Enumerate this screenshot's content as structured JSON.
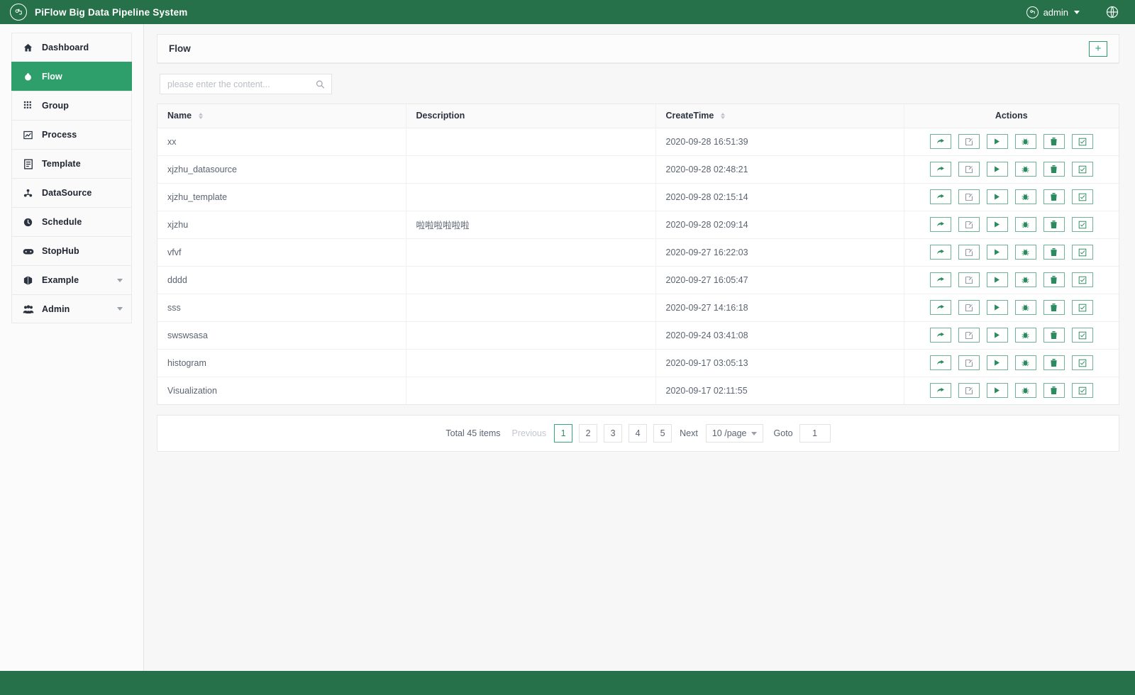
{
  "header": {
    "logo_icon": "piflow-logo-icon",
    "title": "PiFlow Big Data Pipeline System",
    "user": "admin",
    "user_icon": "user-avatar-icon",
    "dropdown_icon": "caret-down-icon",
    "language_icon": "globe-icon",
    "bg_color": "#27714a"
  },
  "sidebar": {
    "items": [
      {
        "label": "Dashboard",
        "icon": "home-icon",
        "active": false,
        "expandable": false
      },
      {
        "label": "Flow",
        "icon": "flow-icon",
        "active": true,
        "expandable": false
      },
      {
        "label": "Group",
        "icon": "grid-icon",
        "active": false,
        "expandable": false
      },
      {
        "label": "Process",
        "icon": "chart-icon",
        "active": false,
        "expandable": false
      },
      {
        "label": "Template",
        "icon": "document-icon",
        "active": false,
        "expandable": false
      },
      {
        "label": "DataSource",
        "icon": "database-icon",
        "active": false,
        "expandable": false
      },
      {
        "label": "Schedule",
        "icon": "clock-icon",
        "active": false,
        "expandable": false
      },
      {
        "label": "StopHub",
        "icon": "stophub-icon",
        "active": false,
        "expandable": false
      },
      {
        "label": "Example",
        "icon": "box-icon",
        "active": false,
        "expandable": true
      },
      {
        "label": "Admin",
        "icon": "users-icon",
        "active": false,
        "expandable": true
      }
    ],
    "active_color": "#2e9e6b"
  },
  "panel": {
    "title": "Flow",
    "add_button_icon": "plus-icon",
    "add_button_label": "+"
  },
  "search": {
    "placeholder": "please enter the content...",
    "value": "",
    "icon": "search-icon"
  },
  "table": {
    "columns": [
      {
        "key": "name",
        "label": "Name",
        "sortable": true
      },
      {
        "key": "description",
        "label": "Description",
        "sortable": false
      },
      {
        "key": "createtime",
        "label": "CreateTime",
        "sortable": true
      },
      {
        "key": "actions",
        "label": "Actions",
        "sortable": false
      }
    ],
    "action_buttons": [
      {
        "name": "share-icon",
        "title": "share"
      },
      {
        "name": "edit-icon",
        "title": "edit"
      },
      {
        "name": "run-icon",
        "title": "run"
      },
      {
        "name": "debug-icon",
        "title": "debug"
      },
      {
        "name": "delete-icon",
        "title": "delete"
      },
      {
        "name": "check-square-icon",
        "title": "select"
      }
    ],
    "rows": [
      {
        "name": "xx",
        "description": "",
        "createtime": "2020-09-28 16:51:39"
      },
      {
        "name": "xjzhu_datasource",
        "description": "",
        "createtime": "2020-09-28 02:48:21"
      },
      {
        "name": "xjzhu_template",
        "description": "",
        "createtime": "2020-09-28 02:15:14"
      },
      {
        "name": "xjzhu",
        "description": "啦啦啦啦啦啦",
        "createtime": "2020-09-28 02:09:14"
      },
      {
        "name": "vfvf",
        "description": "",
        "createtime": "2020-09-27 16:22:03"
      },
      {
        "name": "dddd",
        "description": "",
        "createtime": "2020-09-27 16:05:47"
      },
      {
        "name": "sss",
        "description": "",
        "createtime": "2020-09-27 14:16:18"
      },
      {
        "name": "swswsasa",
        "description": "",
        "createtime": "2020-09-24 03:41:08"
      },
      {
        "name": "histogram",
        "description": "",
        "createtime": "2020-09-17 03:05:13"
      },
      {
        "name": "Visualization",
        "description": "",
        "createtime": "2020-09-17 02:11:55"
      }
    ]
  },
  "pagination": {
    "total_text": "Total 45 items",
    "previous_label": "Previous",
    "next_label": "Next",
    "pages": [
      "1",
      "2",
      "3",
      "4",
      "5"
    ],
    "current_page": "1",
    "page_size_label": "10 /page",
    "goto_label": "Goto",
    "goto_value": "1"
  },
  "footer": {
    "bg_color": "#27714a"
  }
}
